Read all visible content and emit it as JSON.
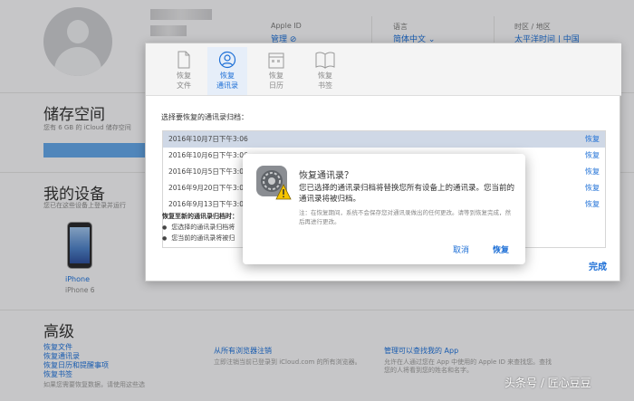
{
  "header": {
    "apple_id_label": "Apple ID",
    "apple_id_value": "管理 ⊘",
    "language_label": "语言",
    "language_value": "简体中文 ⌄",
    "timezone_label": "时区 / 地区",
    "timezone_value": "太平洋时间 | 中国"
  },
  "storage": {
    "title": "储存空间",
    "desc": "您有 6 GB 的 iCloud 储存空间"
  },
  "devices": {
    "title": "我的设备",
    "desc": "您已在这些设备上登录并运行",
    "device_name": "iPhone",
    "device_model": "iPhone 6"
  },
  "advanced": {
    "title": "高级",
    "links": [
      "恢复文件",
      "恢复通讯录",
      "恢复日历和提醒事项",
      "恢复书签"
    ],
    "footnote": "如果您需要恢复数据，请使用这些选",
    "col2_title": "从所有浏览器注销",
    "col2_text": "立即注销当前已登录到 iCloud.com 的所有浏览器。",
    "col3_title": "管理可以查找我的 App",
    "col3_text": "允许在人通过您在 App 中使用的 Apple ID 来查找您。查找您的人将看到您的姓名和名字。"
  },
  "dialog": {
    "tabs": [
      {
        "line1": "恢复",
        "line2": "文件",
        "icon": "document-icon"
      },
      {
        "line1": "恢复",
        "line2": "通讯录",
        "icon": "contacts-icon"
      },
      {
        "line1": "恢复",
        "line2": "日历",
        "icon": "calendar-icon"
      },
      {
        "line1": "恢复",
        "line2": "书签",
        "icon": "bookmark-icon"
      }
    ],
    "prompt": "选择要恢复的通讯录归档：",
    "archives": [
      {
        "date": "2016年10月7日下午3:06",
        "action": "恢复"
      },
      {
        "date": "2016年10月6日下午3:06",
        "action": "恢复"
      },
      {
        "date": "2016年10月5日下午3:06",
        "action": "恢复"
      },
      {
        "date": "2016年9月20日下午3:06",
        "action": "恢复"
      },
      {
        "date": "2016年9月13日下午3:05",
        "action": "恢复"
      }
    ],
    "warning_title": "恢复至新的通讯录归档时：",
    "bullets": [
      "您选择的通讯录归档将",
      "您当前的通讯录将被归"
    ],
    "done": "完成"
  },
  "confirm": {
    "title": "恢复通讯录？",
    "body": "您已选择的通讯录归档将替换您所有设备上的通讯录。您当前的通讯录将被归档。",
    "note": "注：在恢复期间，系统不会保存您对通讯录做出的任何更改。请等到恢复完成，然后再进行更改。",
    "cancel": "取消",
    "restore": "恢复",
    "icon": "settings-warning-icon"
  },
  "watermark": "头条号 / 匠心豆豆",
  "colors": {
    "accent": "#1d6fd6",
    "selected_row": "#cfd8e6"
  }
}
